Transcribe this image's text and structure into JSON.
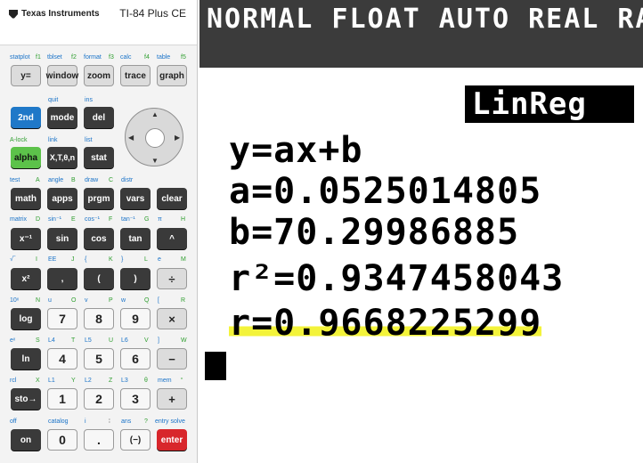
{
  "calculator": {
    "brand": "Texas Instruments",
    "model": "TI-84 Plus CE",
    "row1": {
      "labels": [
        "statplot",
        "f1",
        "tblset",
        "f2",
        "format",
        "f3",
        "calc",
        "f4",
        "table",
        "f5"
      ],
      "keys": [
        "y=",
        "window",
        "zoom",
        "trace",
        "graph"
      ]
    },
    "row2": {
      "labels": [
        "quit",
        "ins"
      ],
      "keys": [
        "2nd",
        "mode",
        "del"
      ]
    },
    "row3": {
      "labels": [
        "A-lock",
        "link",
        "list"
      ],
      "keys": [
        "alpha",
        "X,T,θ,n",
        "stat"
      ]
    },
    "row4": {
      "labels": [
        "test",
        "A",
        "angle",
        "B",
        "draw",
        "C",
        "distr"
      ],
      "keys": [
        "math",
        "apps",
        "prgm",
        "vars",
        "clear"
      ]
    },
    "row5": {
      "labels": [
        "matrix",
        "D",
        "sin⁻¹",
        "E",
        "cos⁻¹",
        "F",
        "tan⁻¹",
        "G",
        "π",
        "H"
      ],
      "keys": [
        "x⁻¹",
        "sin",
        "cos",
        "tan",
        "^"
      ]
    },
    "row6": {
      "labels": [
        "√‾",
        "I",
        "EE",
        "J",
        "{",
        "K",
        "}",
        "L",
        "e",
        "M"
      ],
      "keys": [
        "x²",
        ",",
        "(",
        ")",
        "÷"
      ]
    },
    "row7": {
      "labels": [
        "10ˣ",
        "N",
        "u",
        "O",
        "v",
        "P",
        "w",
        "Q",
        "[",
        "R"
      ],
      "keys": [
        "log",
        "7",
        "8",
        "9",
        "×"
      ]
    },
    "row8": {
      "labels": [
        "eˣ",
        "S",
        "L4",
        "T",
        "L5",
        "U",
        "L6",
        "V",
        "]",
        "W"
      ],
      "keys": [
        "ln",
        "4",
        "5",
        "6",
        "−"
      ]
    },
    "row9": {
      "labels": [
        "rcl",
        "X",
        "L1",
        "Y",
        "L2",
        "Z",
        "L3",
        "θ",
        "mem",
        "“"
      ],
      "keys": [
        "sto→",
        "1",
        "2",
        "3",
        "+"
      ]
    },
    "row10": {
      "labels": [
        "off",
        "catalog",
        "i",
        "∶",
        "ans",
        "?",
        "entry solve"
      ],
      "keys": [
        "on",
        "0",
        ".",
        "(−)",
        "enter"
      ]
    }
  },
  "screen": {
    "status": "NORMAL FLOAT AUTO REAL RA",
    "title": "LinReg",
    "lines": [
      "y=ax+b",
      "a=0.0525014805",
      "b=70.29986885",
      "r²=0.9347458043",
      "r=0.9668225299"
    ],
    "colors": {
      "status_bg": "#3b3b3b",
      "highlight": "#f3f33a",
      "key_blue": "#1f78c8",
      "key_green": "#5cc24a",
      "key_red": "#d8262b"
    }
  }
}
